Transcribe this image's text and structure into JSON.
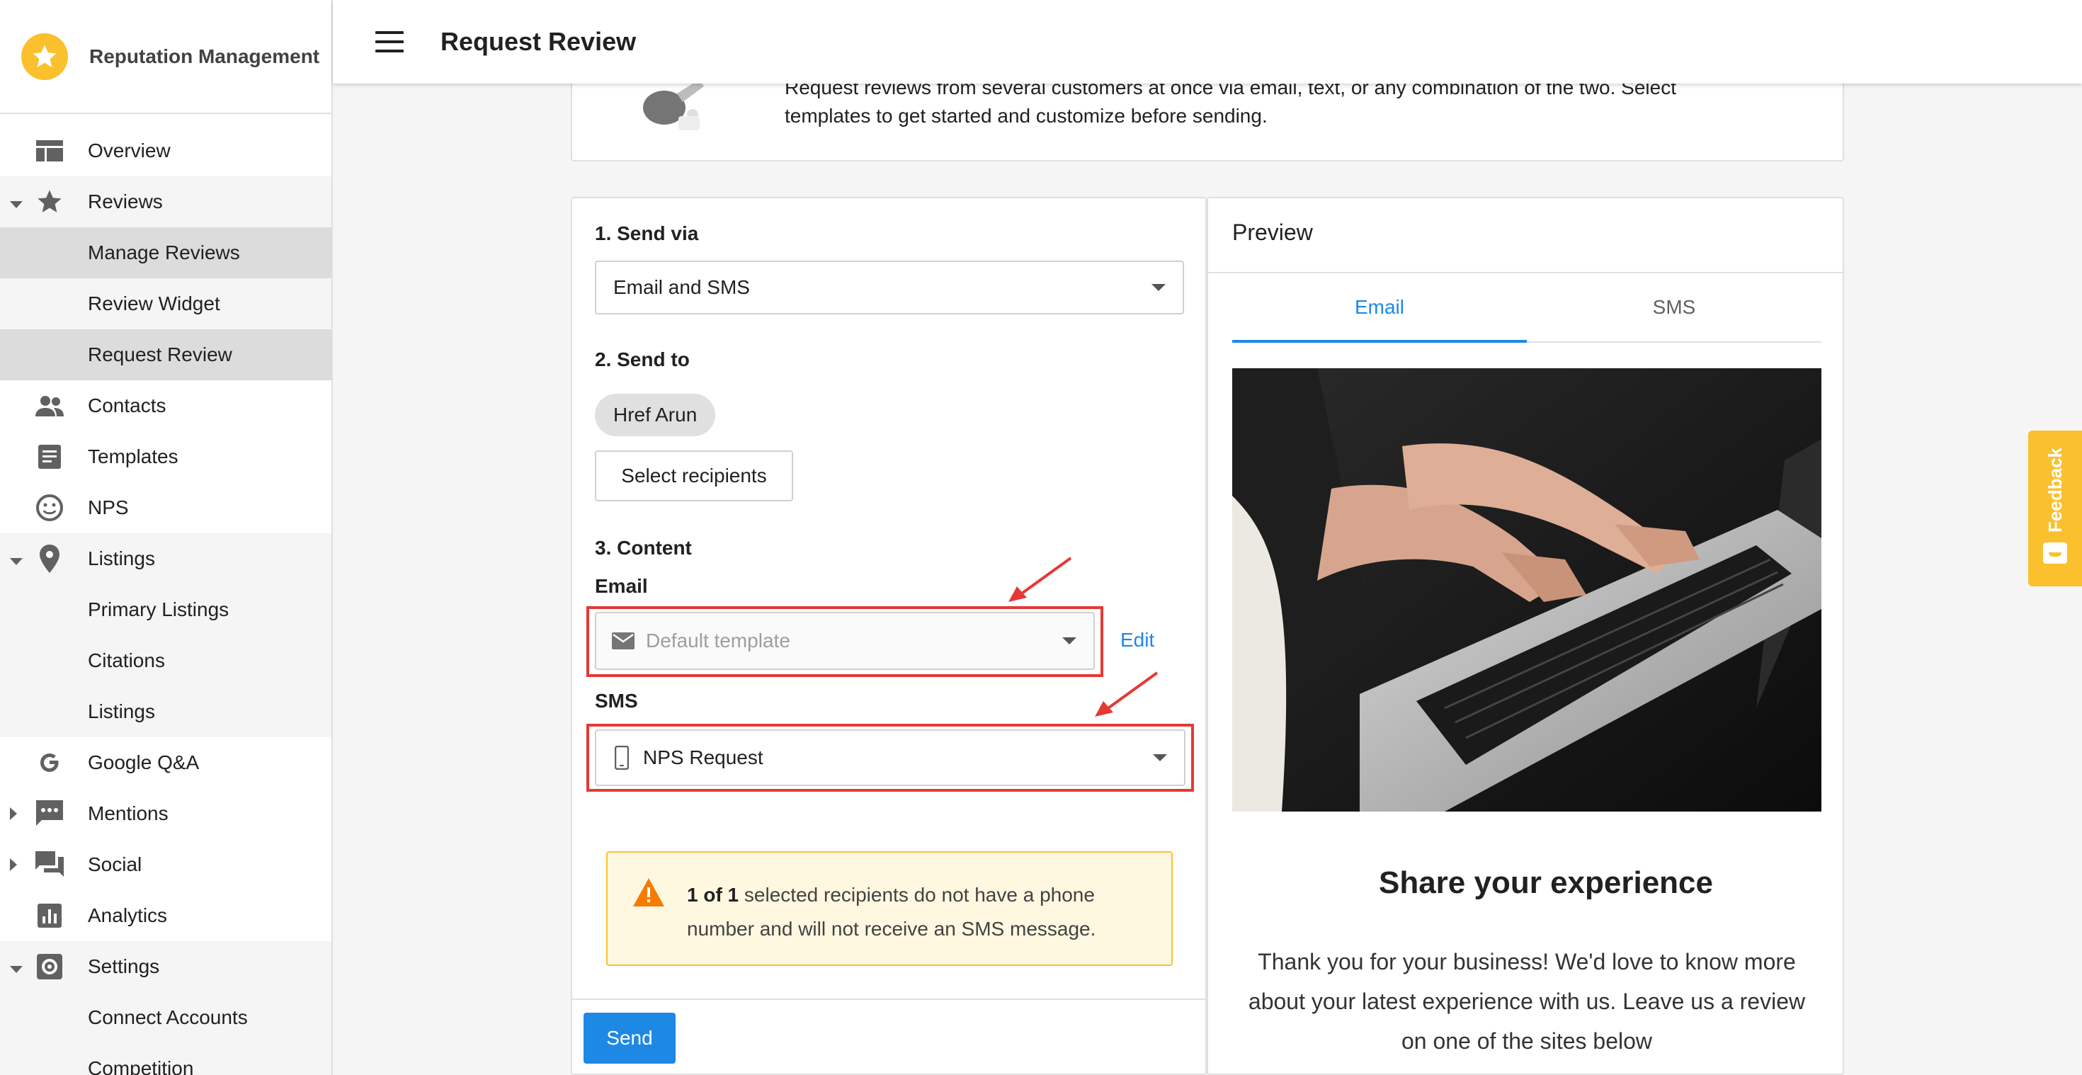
{
  "app": {
    "name": "Reputation Management"
  },
  "topbar": {
    "title": "Request Review"
  },
  "sidebar": {
    "items": [
      {
        "label": "Overview"
      },
      {
        "label": "Reviews"
      },
      {
        "label": "Manage Reviews"
      },
      {
        "label": "Review Widget"
      },
      {
        "label": "Request Review"
      },
      {
        "label": "Contacts"
      },
      {
        "label": "Templates"
      },
      {
        "label": "NPS"
      },
      {
        "label": "Listings"
      },
      {
        "label": "Primary Listings"
      },
      {
        "label": "Citations"
      },
      {
        "label": "Listings"
      },
      {
        "label": "Google Q&A"
      },
      {
        "label": "Mentions"
      },
      {
        "label": "Social"
      },
      {
        "label": "Analytics"
      },
      {
        "label": "Settings"
      },
      {
        "label": "Connect Accounts"
      },
      {
        "label": "Competition"
      }
    ]
  },
  "intro": {
    "line1": "Request reviews from several customers at once via email, text, or any combination of the two. Select",
    "line2": "templates to get started and customize before sending."
  },
  "form": {
    "send_via_label": "1. Send via",
    "send_via_value": "Email and SMS",
    "send_to_label": "2. Send to",
    "recipient_chip": "Href Arun",
    "select_recipients": "Select recipients",
    "content_label": "3. Content",
    "email_label": "Email",
    "email_placeholder": "Default template",
    "edit_link": "Edit",
    "sms_label": "SMS",
    "sms_value": "NPS Request",
    "warning_bold": "1 of 1",
    "warning_rest": " selected recipients do not have a phone",
    "warning_line2": "number and will not receive an SMS message.",
    "send_button": "Send"
  },
  "preview": {
    "title": "Preview",
    "tabs": [
      {
        "label": "Email"
      },
      {
        "label": "SMS"
      }
    ],
    "active_tab": "Email",
    "heading": "Share your experience",
    "body_line1": "Thank you for your business! We'd love to know more",
    "body_line2": "about your latest experience with us. Leave us a review",
    "body_line3": "on one of the sites below"
  },
  "feedback": {
    "label": "Feedback"
  },
  "colors": {
    "accent": "#1e88e5",
    "brand": "#fbc02d",
    "highlight": "#e53935",
    "warning_bg": "#fff8e1"
  }
}
